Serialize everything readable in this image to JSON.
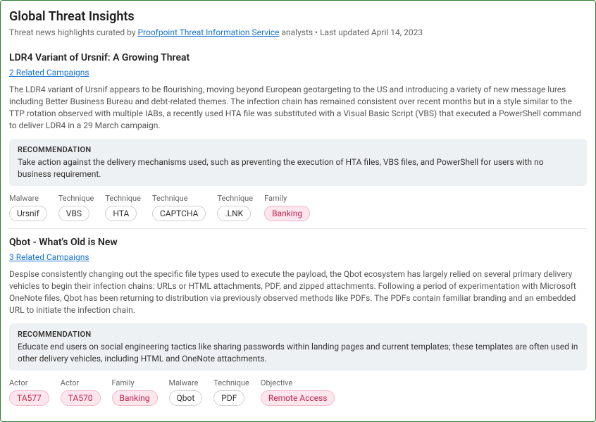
{
  "header": {
    "title": "Global Threat Insights",
    "sub_prefix": "Threat news highlights curated by ",
    "service_link": "Proofpoint Threat Information Service",
    "sub_suffix": " analysts • Last updated April 14, 2023"
  },
  "articles": [
    {
      "title": "LDR4 Variant of Ursnif: A Growing Threat",
      "related": "2 Related Campaigns",
      "body": "The LDR4 variant of Ursnif appears to be flourishing, moving beyond European geotargeting to the US and introducing a variety of new message lures including Better Business Bureau and debt-related themes. The infection chain has remained consistent over recent months but in a style similar to the TTP rotation observed with multiple IABs, a recently used HTA file was substituted with a Visual Basic Script (VBS) that executed a PowerShell command to deliver LDR4 in a 29 March campaign.",
      "reco_title": "RECOMMENDATION",
      "reco_body": "Take action against the delivery mechanisms used, such as preventing the execution of HTA files, VBS files, and PowerShell for users with no business requirement.",
      "tags": [
        {
          "label": "Malware",
          "value": "Ursnif",
          "style": "gray"
        },
        {
          "label": "Technique",
          "value": "VBS",
          "style": "gray"
        },
        {
          "label": "Technique",
          "value": "HTA",
          "style": "gray"
        },
        {
          "label": "Technique",
          "value": "CAPTCHA",
          "style": "gray"
        },
        {
          "label": "Technique",
          "value": ".LNK",
          "style": "gray"
        },
        {
          "label": "Family",
          "value": "Banking",
          "style": "pink"
        }
      ]
    },
    {
      "title": "Qbot - What's Old is New",
      "related": "3 Related Campaigns",
      "body": "Despise consistently changing out the specific file types used to execute the payload, the Qbot ecosystem has largely relied on several primary delivery vehicles to begin their infection chains: URLs or HTML attachments, PDF, and zipped attachments. Following a period of experimentation with Microsoft OneNote files, Qbot has been returning to distribution via previously observed methods like PDFs. The PDFs contain familiar branding and an embedded URL to initiate the infection chain.",
      "reco_title": "RECOMMENDATION",
      "reco_body": "Educate end users on social engineering tactics like sharing passwords within landing pages and current templates; these templates are often used in other delivery vehicles, including HTML and OneNote attachments.",
      "tags": [
        {
          "label": "Actor",
          "value": "TA577",
          "style": "pink"
        },
        {
          "label": "Actor",
          "value": "TA570",
          "style": "pink"
        },
        {
          "label": "Family",
          "value": "Banking",
          "style": "pink"
        },
        {
          "label": "Malware",
          "value": "Qbot",
          "style": "gray"
        },
        {
          "label": "Technique",
          "value": "PDF",
          "style": "gray"
        },
        {
          "label": "Objective",
          "value": "Remote Access",
          "style": "pink"
        }
      ]
    }
  ]
}
